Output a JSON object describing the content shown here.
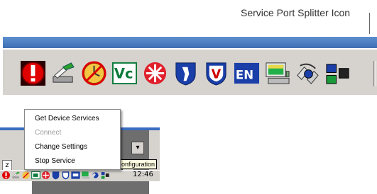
{
  "caption": "Service Port Splitter Icon",
  "menu": {
    "items": [
      {
        "label": "Get Device Services",
        "enabled": true
      },
      {
        "label": "Connect",
        "enabled": false
      },
      {
        "label": "Change Settings",
        "enabled": true
      },
      {
        "label": "Stop Service",
        "enabled": true
      }
    ]
  },
  "tooltip": "onfiguration",
  "clock": "12:46",
  "window": {
    "zoom_label": "z"
  },
  "tray_icons": [
    {
      "name": "red-exclamation-icon",
      "label": ""
    },
    {
      "name": "network-plug-icon",
      "label": ""
    },
    {
      "name": "no-entry-clock-icon",
      "label": ""
    },
    {
      "name": "vnc-icon",
      "label": "Vc"
    },
    {
      "name": "red-star-icon",
      "label": ""
    },
    {
      "name": "shield-figure-icon",
      "label": ""
    },
    {
      "name": "shield-v-icon",
      "label": "V"
    },
    {
      "name": "language-en-icon",
      "label": "EN"
    },
    {
      "name": "monitor-keyboard-icon",
      "label": ""
    },
    {
      "name": "service-port-splitter-icon",
      "label": ""
    },
    {
      "name": "sound-device-icon",
      "label": ""
    }
  ],
  "colors": {
    "title_blue": "#4a7ec4",
    "face_gray": "#d6d3ce",
    "menu_bg": "#ffffff",
    "disabled_text": "#9c9c9c",
    "tooltip_bg": "#ffffe1"
  }
}
